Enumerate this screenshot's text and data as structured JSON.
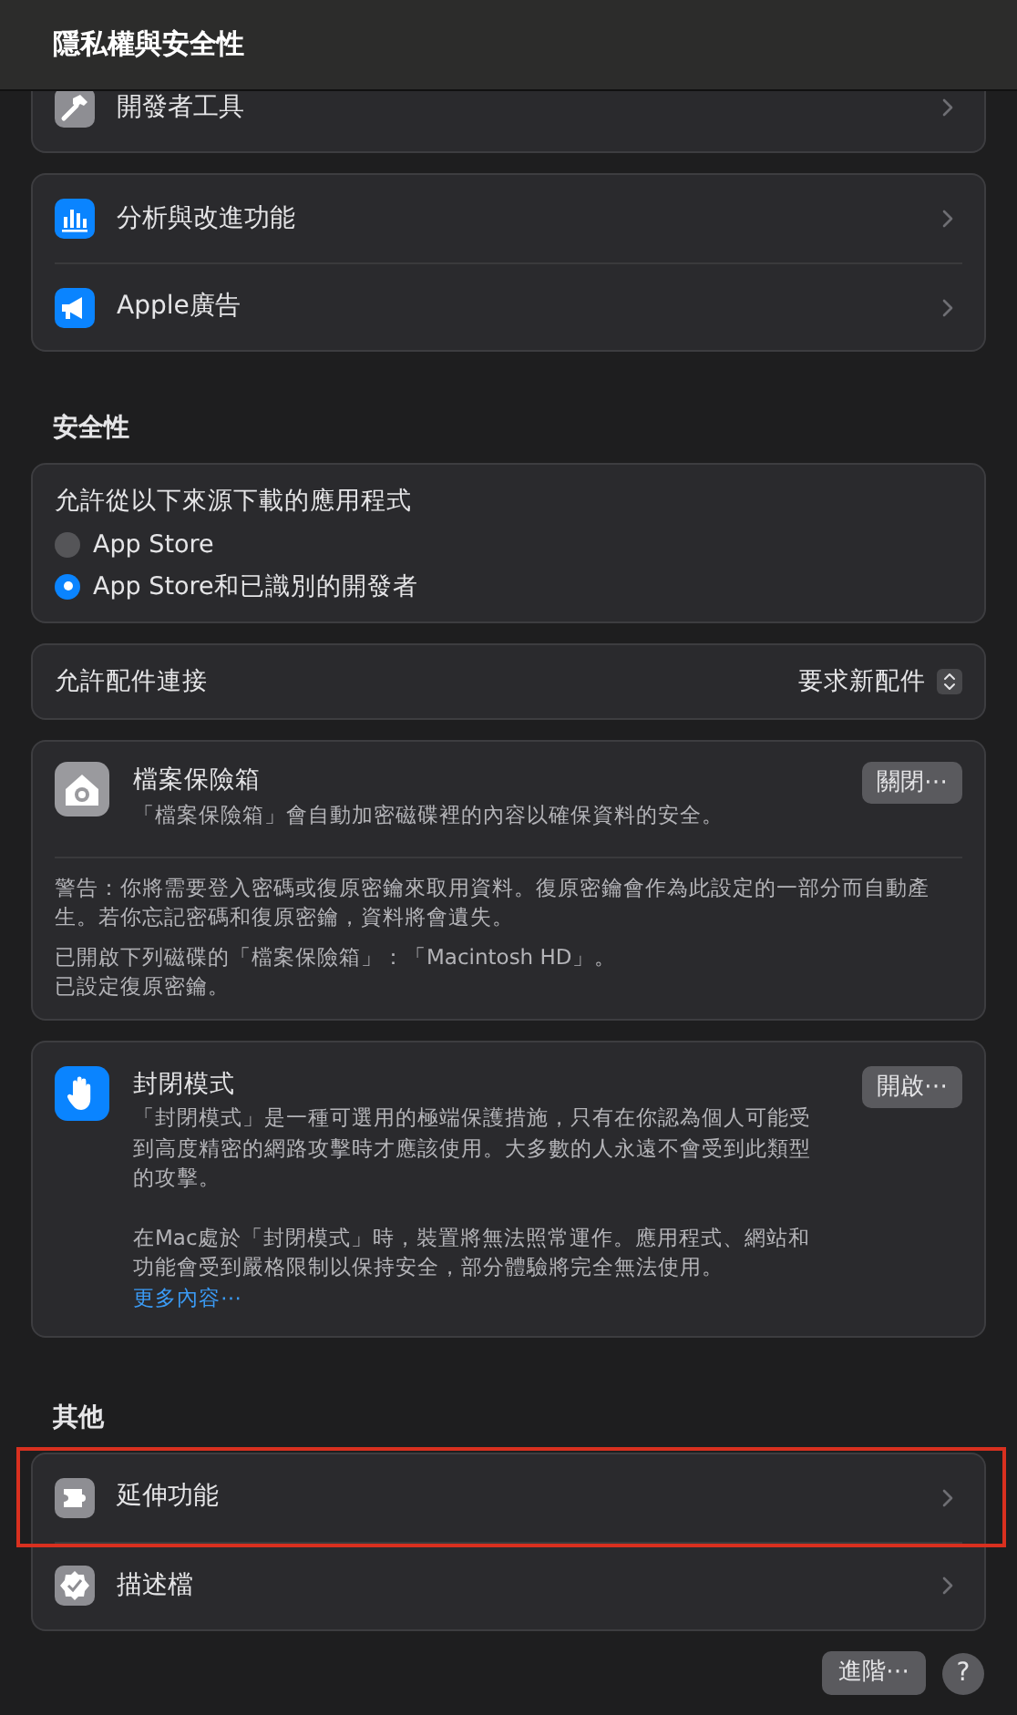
{
  "window": {
    "title": "隱私權與安全性"
  },
  "privacy_groups": [
    {
      "cut": true,
      "rows": [
        {
          "label": "開發者工具"
        }
      ]
    },
    {
      "cut": false,
      "rows": [
        {
          "label": "分析與改進功能"
        },
        {
          "label": "Apple廣告"
        }
      ]
    }
  ],
  "security": {
    "heading": "安全性",
    "downloads": {
      "label": "允許從以下來源下載的應用程式",
      "options": [
        {
          "label": "App Store",
          "selected": false
        },
        {
          "label": "App Store和已識別的開發者",
          "selected": true
        }
      ]
    },
    "accessories": {
      "label": "允許配件連接",
      "value": "要求新配件"
    },
    "filevault": {
      "title": "檔案保險箱",
      "description": "「檔案保險箱」會自動加密磁碟裡的內容以確保資料的安全。",
      "button": "關閉⋯",
      "warning": "警告：你將需要登入密碼或復原密鑰來取用資料。復原密鑰會作為此設定的一部分而自動產生。若你忘記密碼和復原密鑰，資料將會遺失。",
      "status": [
        "已開啟下列磁碟的「檔案保險箱」：「Macintosh HD」。",
        "已設定復原密鑰。"
      ]
    },
    "lockdown": {
      "title": "封閉模式",
      "paragraphs": [
        "「封閉模式」是一種可選用的極端保護措施，只有在你認為個人可能受到高度精密的網路攻擊時才應該使用。大多數的人永遠不會受到此類型的攻擊。",
        "在Mac處於「封閉模式」時，裝置將無法照常運作。應用程式、網站和功能會受到嚴格限制以保持安全，部分體驗將完全無法使用。"
      ],
      "link": "更多內容⋯",
      "button": "開啟⋯"
    }
  },
  "other": {
    "heading": "其他",
    "rows": [
      {
        "label": "延伸功能",
        "highlighted": true
      },
      {
        "label": "描述檔",
        "highlighted": false
      }
    ]
  },
  "footer": {
    "advanced_button": "進階⋯",
    "help_button": "?"
  }
}
